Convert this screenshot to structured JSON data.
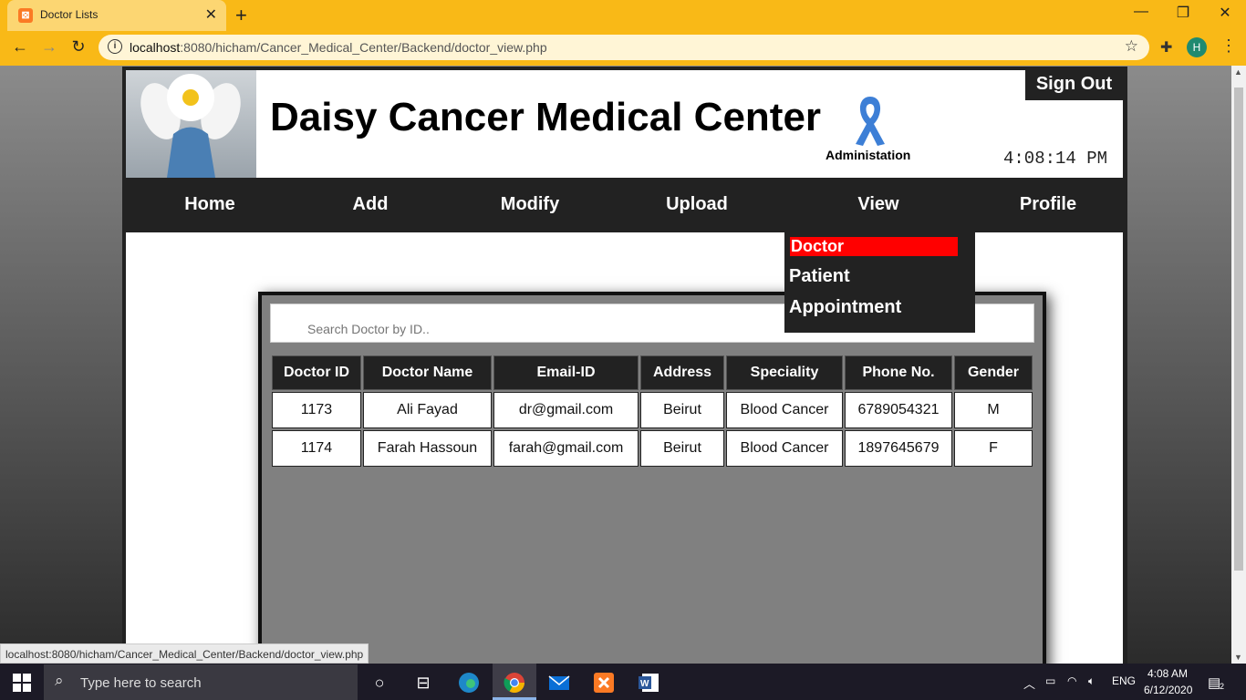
{
  "browser": {
    "tab_title": "Doctor Lists",
    "tab_favicon": "xampp-icon",
    "url_host": "localhost",
    "url_rest": ":8080/hicham/Cancer_Medical_Center/Backend/doctor_view.php",
    "profile_initial": "H",
    "status_url": "localhost:8080/hicham/Cancer_Medical_Center/Backend/doctor_view.php"
  },
  "header": {
    "title": "Daisy Cancer Medical Center",
    "admin_label": "Administation",
    "sign_out": "Sign Out",
    "clock": "4:08:14 PM"
  },
  "nav": {
    "items": [
      "Home",
      "Add",
      "Modify",
      "Upload",
      "View",
      "Profile"
    ]
  },
  "dropdown": {
    "items": [
      "Doctor",
      "Patient",
      "Appointment"
    ],
    "selected": "Doctor"
  },
  "search": {
    "placeholder": "Search Doctor by ID.."
  },
  "table": {
    "headers": [
      "Doctor ID",
      "Doctor Name",
      "Email-ID",
      "Address",
      "Speciality",
      "Phone No.",
      "Gender"
    ],
    "rows": [
      [
        "1173",
        "Ali Fayad",
        "dr@gmail.com",
        "Beirut",
        "Blood Cancer",
        "6789054321",
        "M"
      ],
      [
        "1174",
        "Farah Hassoun",
        "farah@gmail.com",
        "Beirut",
        "Blood Cancer",
        "1897645679",
        "F"
      ]
    ]
  },
  "taskbar": {
    "search_text": "Type here to search",
    "lang": "ENG",
    "time": "4:08 AM",
    "date": "6/12/2020",
    "notifications": "2"
  },
  "colors": {
    "browser_accent": "#f9b917",
    "selected_item": "#ff0000",
    "dark_bar": "#222222"
  }
}
